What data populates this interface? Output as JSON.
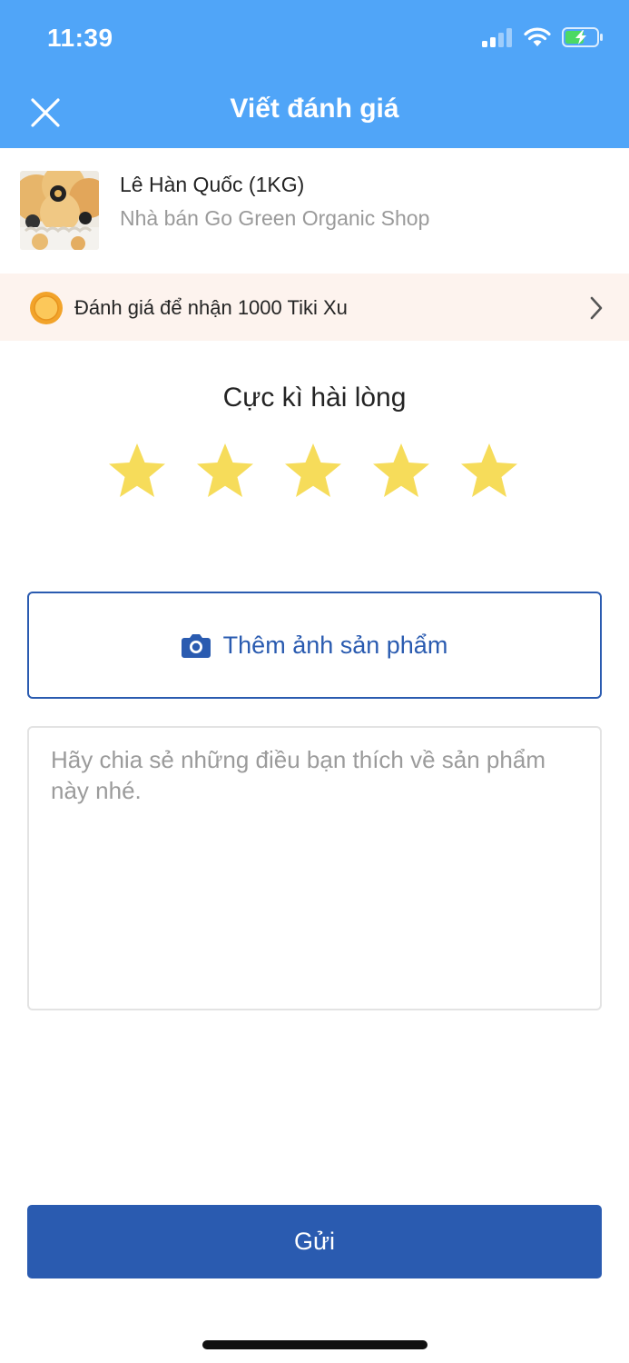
{
  "status_bar": {
    "time": "11:39"
  },
  "header": {
    "title": "Viết đánh giá"
  },
  "product": {
    "name": "Lê Hàn Quốc (1KG)",
    "seller": "Nhà bán Go Green Organic Shop"
  },
  "reward": {
    "text": "Đánh giá để nhận 1000 Tiki Xu"
  },
  "rating": {
    "label": "Cực kì hài lòng",
    "value": 5,
    "max": 5
  },
  "photo_button": {
    "label": "Thêm ảnh sản phẩm"
  },
  "review": {
    "placeholder": "Hãy chia sẻ những điều bạn thích về sản phẩm này nhé.",
    "value": ""
  },
  "submit": {
    "label": "Gửi"
  },
  "colors": {
    "header_bg": "#50a5f8",
    "primary": "#2a5bb0",
    "star": "#f6dc5a",
    "reward_bg": "#fdf3ee"
  }
}
